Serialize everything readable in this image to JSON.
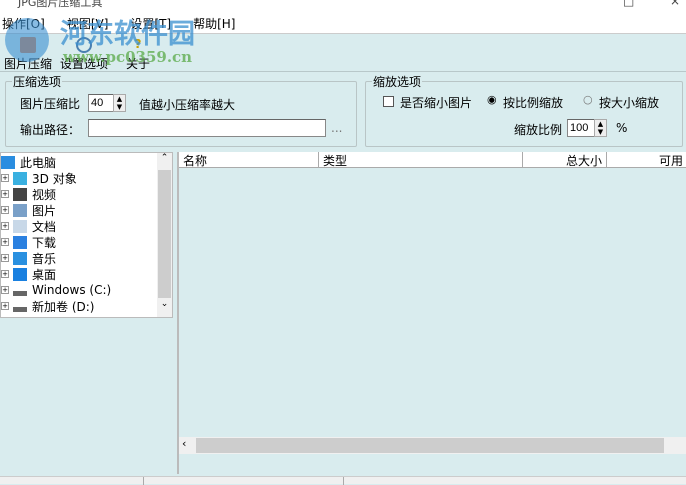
{
  "window": {
    "title": "JPG图片压缩工具"
  },
  "menu": [
    "操作[O]",
    "视图[V]",
    "设置[T]",
    "帮助[H]"
  ],
  "toolbar": [
    {
      "label": "图片压缩",
      "icon": "compress-icon"
    },
    {
      "label": "设置选项",
      "icon": "settings-magnifier-icon"
    },
    {
      "label": "关于",
      "icon": "help-icon"
    }
  ],
  "compress": {
    "legend": "压缩选项",
    "ratio_label": "图片压缩比",
    "ratio_value": "40",
    "hint": "值越小压缩率越大",
    "output_label": "输出路径：",
    "output_value": "",
    "browse": "..."
  },
  "scale": {
    "legend": "缩放选项",
    "shrink_checkbox": "是否缩小图片",
    "shrink_checked": false,
    "radio_ratio": "按比例缩放",
    "radio_size": "按大小缩放",
    "selected": "ratio",
    "ratio_label": "缩放比例",
    "ratio_value": "100",
    "unit": "%"
  },
  "tree": [
    {
      "label": "此电脑",
      "icon": "computer-icon"
    },
    {
      "label": "3D 对象",
      "icon": "cube-icon"
    },
    {
      "label": "视频",
      "icon": "video-icon"
    },
    {
      "label": "图片",
      "icon": "picture-icon"
    },
    {
      "label": "文档",
      "icon": "document-icon"
    },
    {
      "label": "下载",
      "icon": "download-icon"
    },
    {
      "label": "音乐",
      "icon": "music-icon"
    },
    {
      "label": "桌面",
      "icon": "desktop-icon"
    },
    {
      "label": "Windows (C:)",
      "icon": "drive-icon"
    },
    {
      "label": "新加卷 (D:)",
      "icon": "drive-icon"
    }
  ],
  "columns": [
    "名称",
    "类型",
    "总大小",
    "可用"
  ],
  "watermark": {
    "name": "河东软件园",
    "url": "www.pc0359.cn"
  },
  "colors": {
    "bg": "#d9ecee"
  }
}
